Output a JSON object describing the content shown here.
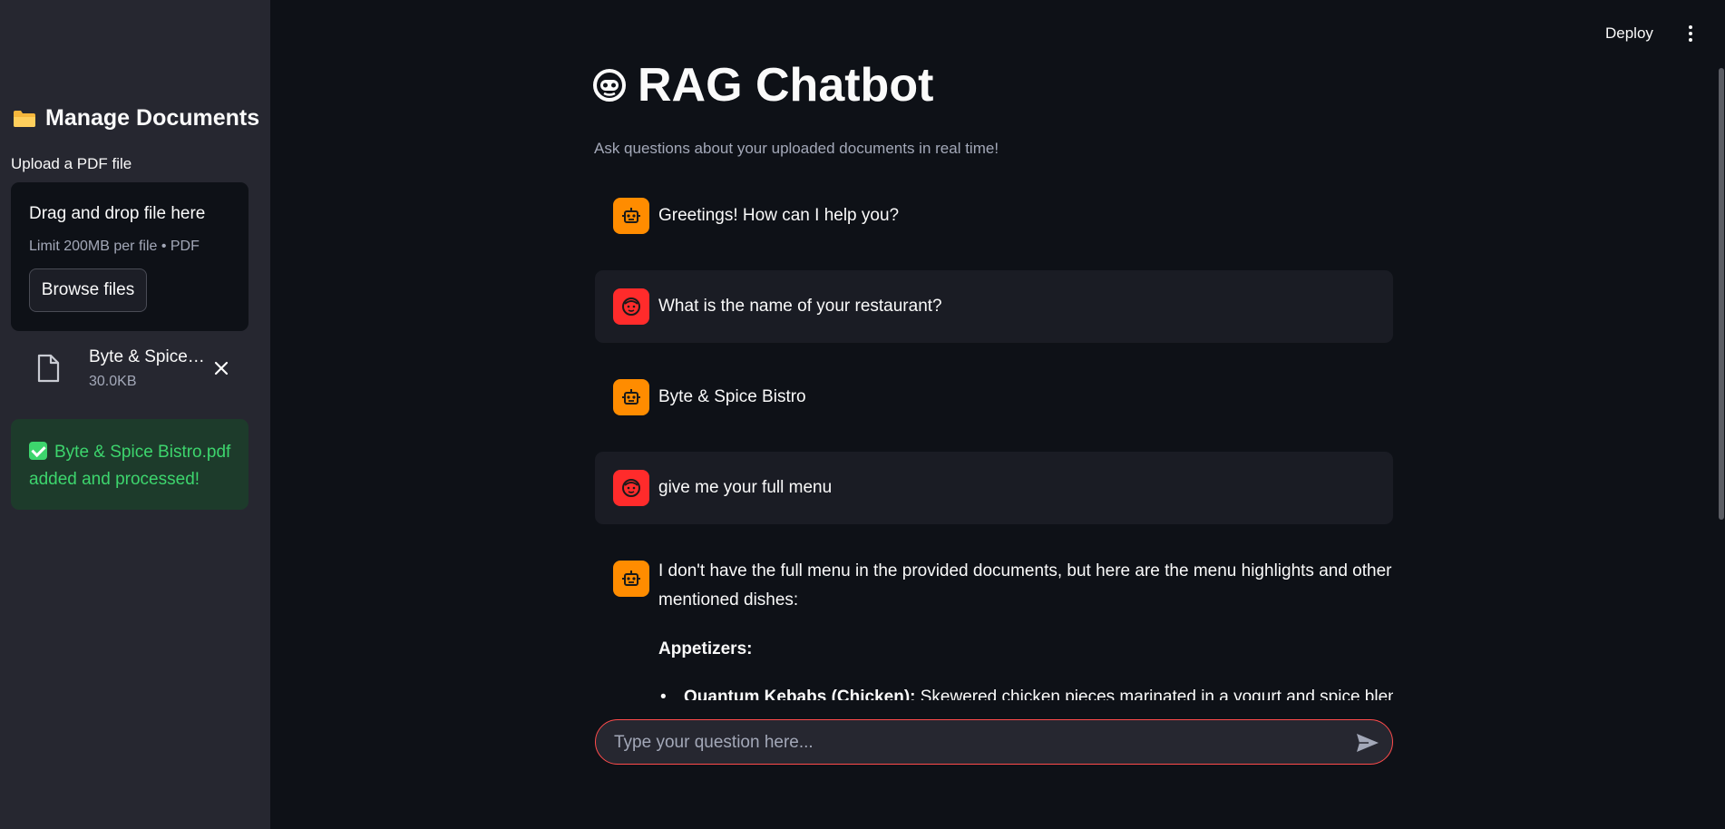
{
  "sidebar": {
    "title": "Manage Documents",
    "upload_label": "Upload a PDF file",
    "dropzone": {
      "title": "Drag and drop file here",
      "limit": "Limit 200MB per file • PDF",
      "browse_label": "Browse files"
    },
    "file": {
      "name": "Byte & Spice Bistro.pdf",
      "size": "30.0KB"
    },
    "success_message": "Byte & Spice Bistro.pdf added and processed!"
  },
  "header": {
    "deploy_label": "Deploy"
  },
  "main": {
    "title": "RAG Chatbot",
    "subtitle": "Ask questions about your uploaded documents in real time!",
    "messages": [
      {
        "role": "assistant",
        "text": "Greetings! How can I help you?"
      },
      {
        "role": "user",
        "text": "What is the name of your restaurant?"
      },
      {
        "role": "assistant",
        "text": "Byte & Spice Bistro"
      },
      {
        "role": "user",
        "text": "give me your full menu"
      },
      {
        "role": "assistant",
        "text": "I don't have the full menu in the provided documents, but here are the menu highlights and other mentioned dishes:",
        "heading": "Appetizers:",
        "bullet_bold": "Quantum Kebabs (Chicken):",
        "bullet_text": " Skewered chicken pieces marinated in a yogurt and spice blend"
      }
    ],
    "input_placeholder": "Type your question here..."
  },
  "colors": {
    "background": "#0e1117",
    "sidebar": "#262730",
    "assistant_avatar": "#ff8c00",
    "user_avatar": "#ff2b2b",
    "success_bg": "#1d3b2b",
    "success_text": "#3dd56d",
    "input_border": "#ff4b4b"
  }
}
